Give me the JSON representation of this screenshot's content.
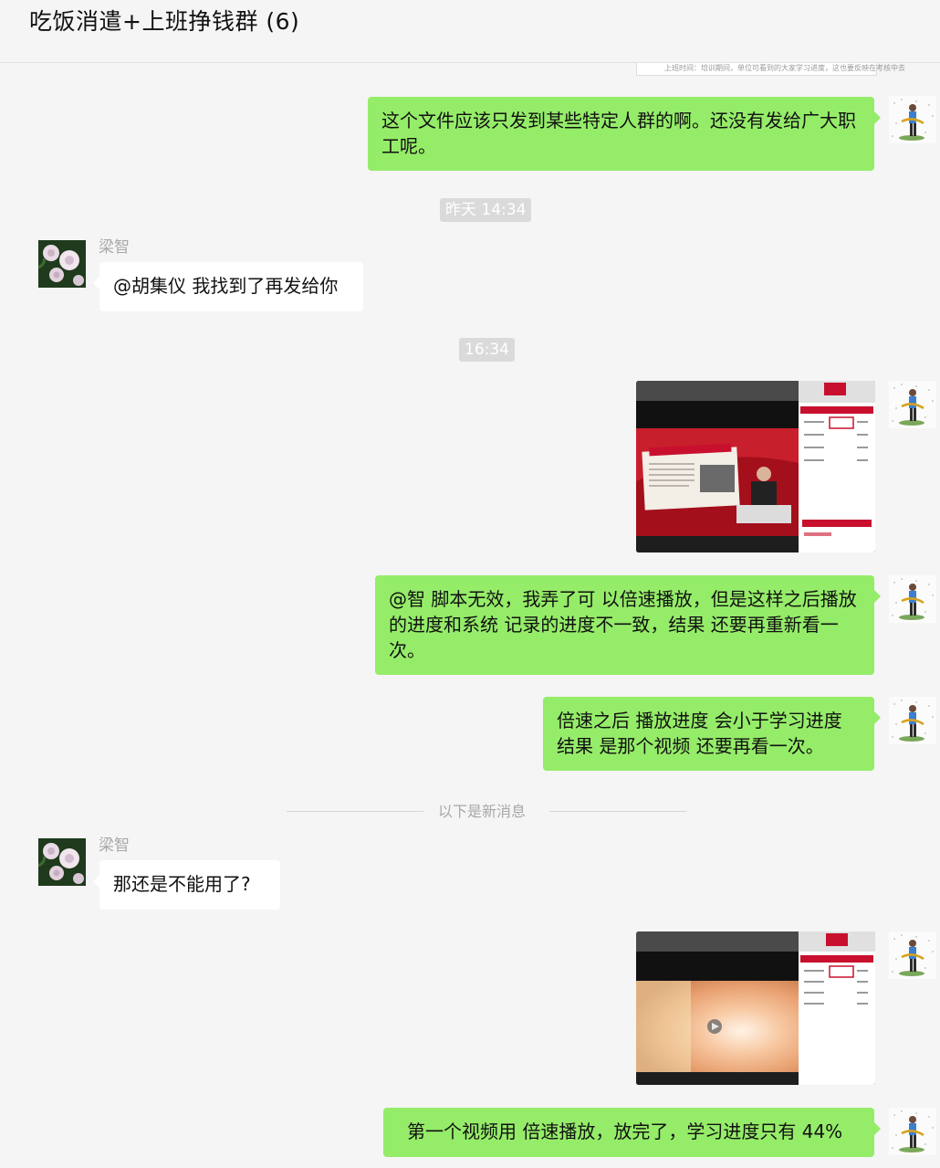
{
  "chat": {
    "title": "吃饭消遣+上班挣钱群 (6)",
    "more_icon": "more-dots-icon"
  },
  "clipped_preview_text": "上班时间：培训期间，单位可看到的大家学习进度，这也要反映在考核中去",
  "messages": {
    "m1": "这个文件应该只发到某些特定人群的啊。还没有发给广大职工呢。",
    "t1": "昨天 14:34",
    "s1": "梁智",
    "m2": "@胡集仪 我找到了再发给你",
    "t2": "16:34",
    "m4": "@智 脚本无效，我弄了可 以倍速播放，但是这样之后播放的进度和系统 记录的进度不一致，结果 还要再重新看一次。",
    "m5": "倍速之后 播放进度  会小于学习进度 结果 是那个视频 还要再看一次。",
    "new_label": "以下是新消息",
    "s2": "梁智",
    "m6": "那还是不能用了?",
    "m8": "第一个视频用 倍速播放，放完了，学习进度只有 44%"
  },
  "colors": {
    "bg": "#f5f5f5",
    "my_bubble": "#95ec69",
    "other_bubble": "#ffffff",
    "accent_red": "#c8102e"
  }
}
